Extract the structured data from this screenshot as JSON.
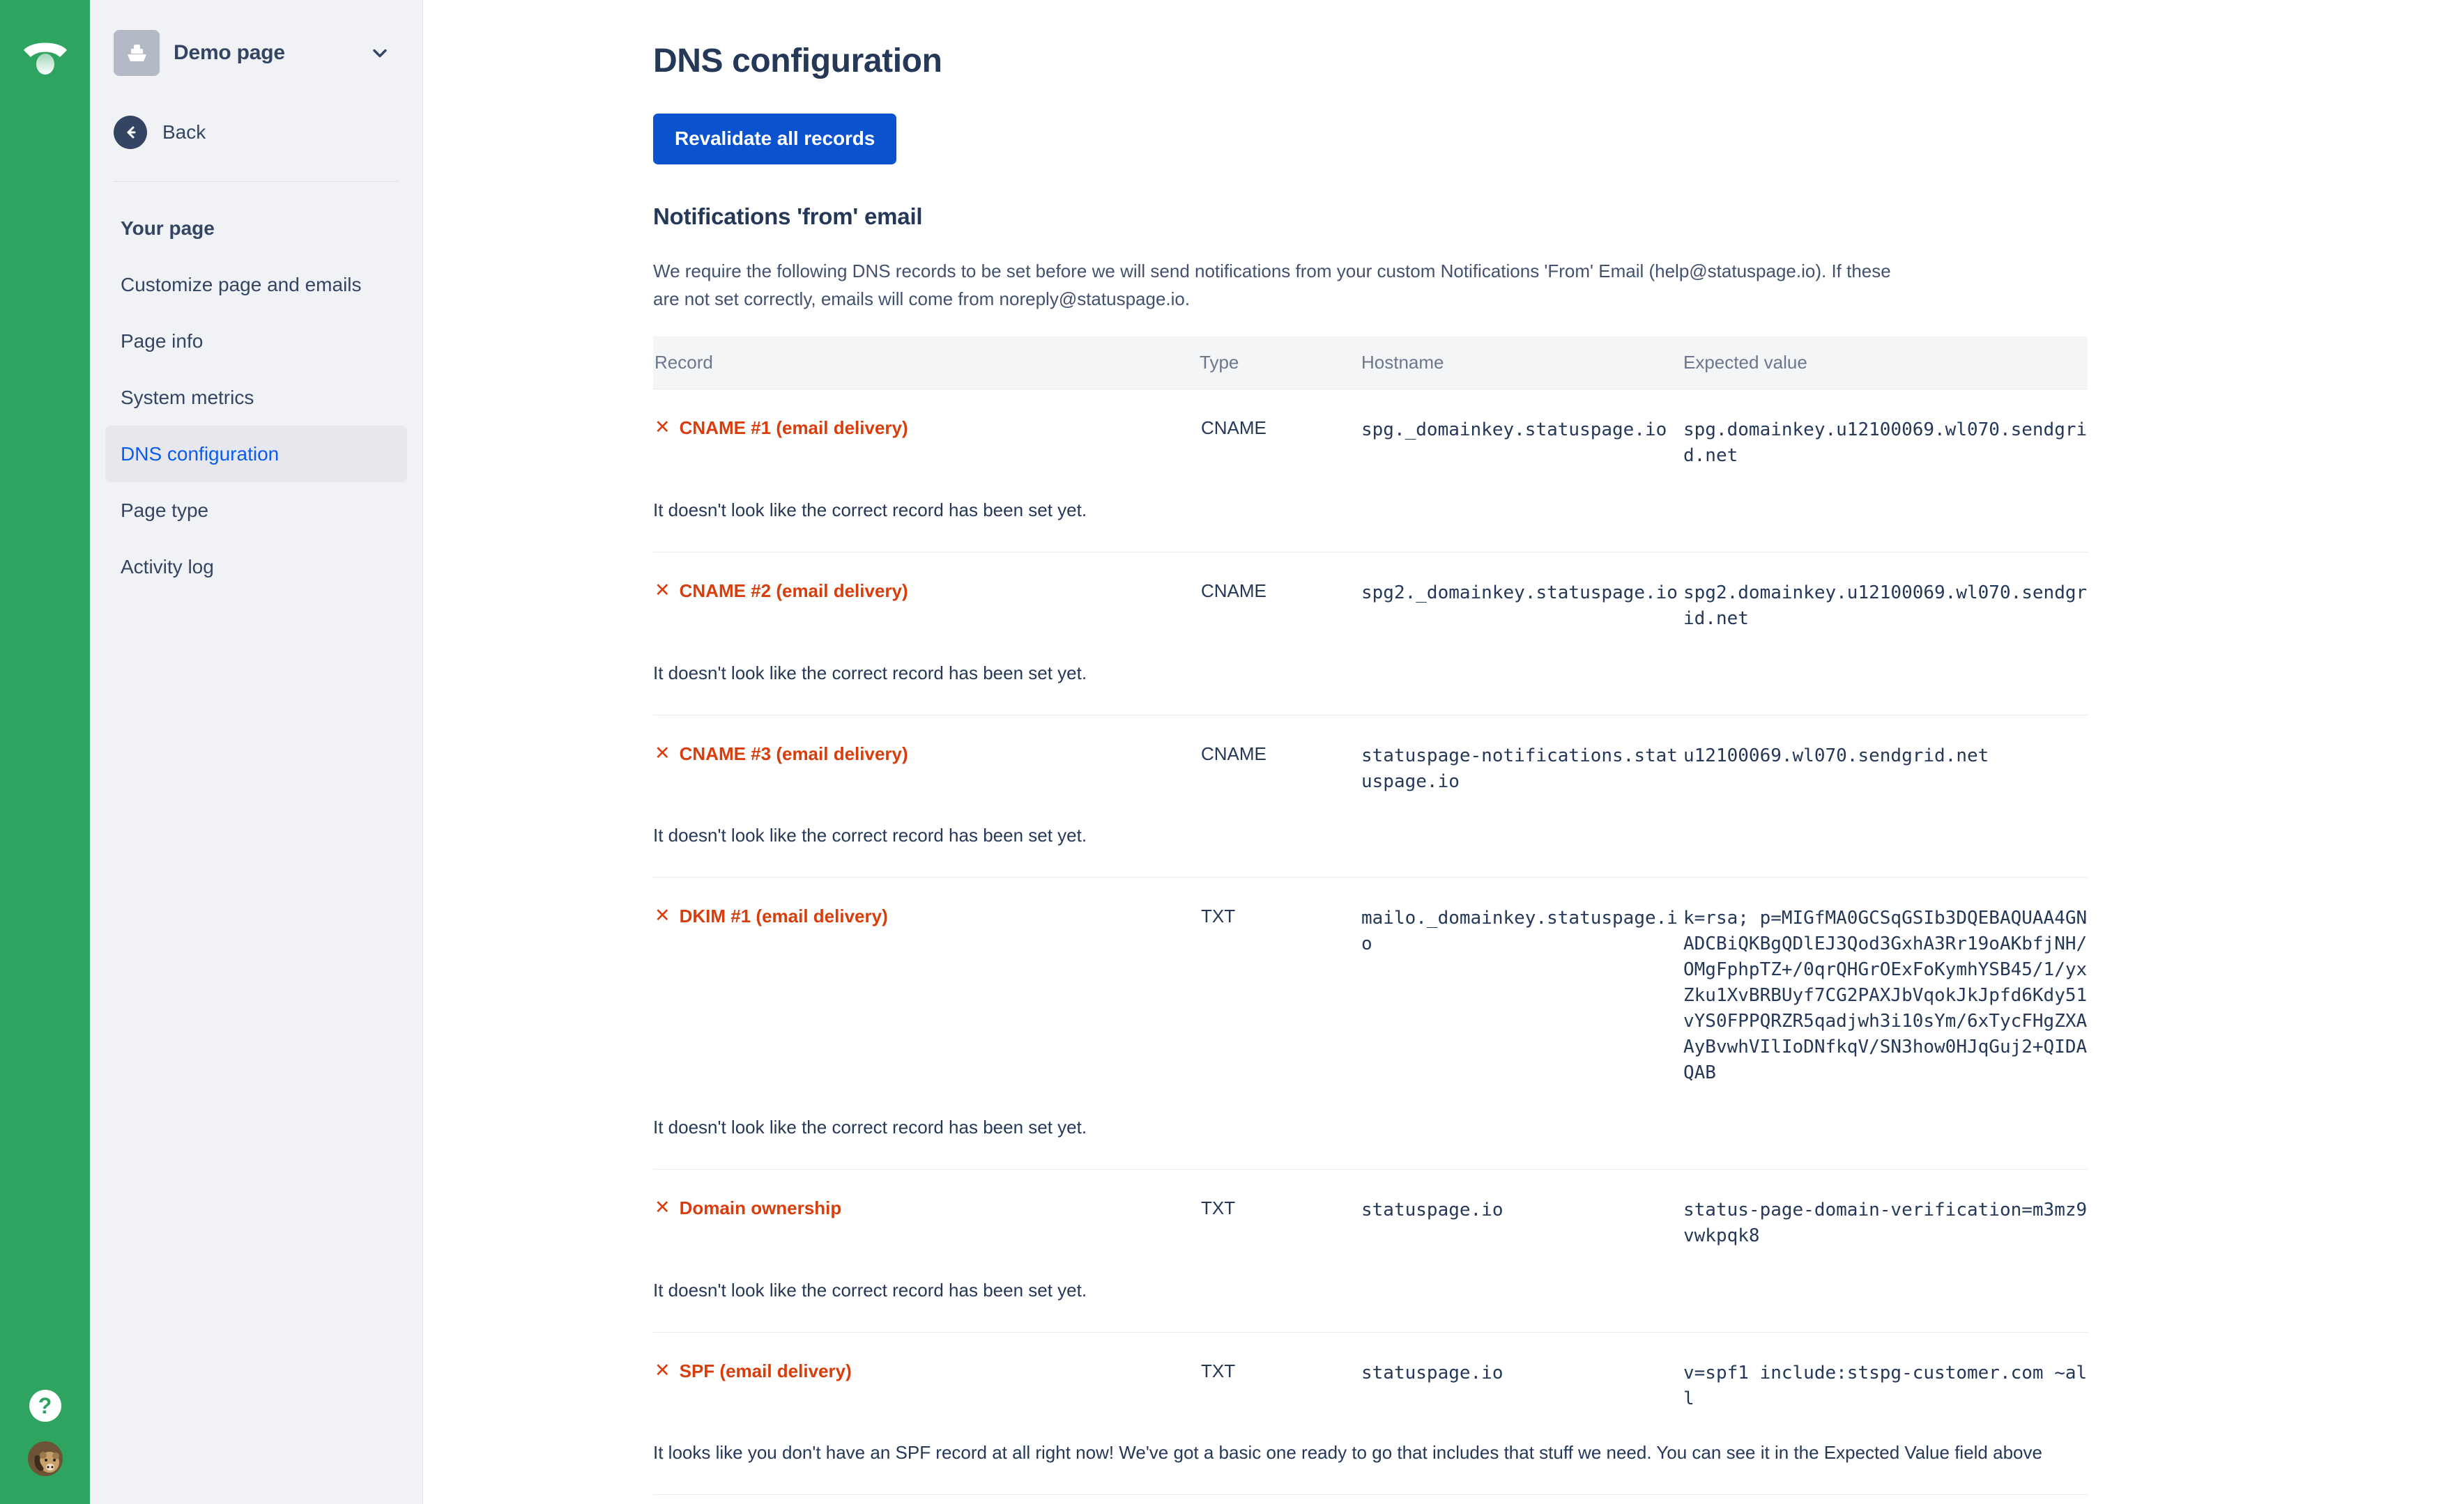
{
  "rail": {
    "logo_icon": "statuspage-logo-icon",
    "help_icon": "question-mark-icon",
    "help_label": "?",
    "avatar_icon": "user-avatar-bear"
  },
  "sidebar": {
    "page_switcher": {
      "thumb_icon": "page-thumbnail-icon",
      "name": "Demo page",
      "chevron_icon": "chevron-down-icon"
    },
    "back": {
      "icon": "arrow-left-circle-icon",
      "label": "Back"
    },
    "nav_items": [
      {
        "label": "Your page",
        "state": "heading"
      },
      {
        "label": "Customize page and emails",
        "state": "normal"
      },
      {
        "label": "Page info",
        "state": "normal"
      },
      {
        "label": "System metrics",
        "state": "normal"
      },
      {
        "label": "DNS configuration",
        "state": "active"
      },
      {
        "label": "Page type",
        "state": "normal"
      },
      {
        "label": "Activity log",
        "state": "normal"
      }
    ]
  },
  "main": {
    "title": "DNS configuration",
    "revalidate_button": "Revalidate all records",
    "section_title": "Notifications 'from' email",
    "section_description": "We require the following DNS records to be set before we will send notifications from your custom Notifications 'From' Email (help@statuspage.io). If these are not set correctly, emails will come from noreply@statuspage.io.",
    "table": {
      "headers": [
        "Record",
        "Type",
        "Hostname",
        "Expected value"
      ],
      "rows": [
        {
          "status_icon": "error-x-icon",
          "record": "CNAME #1 (email delivery)",
          "type": "CNAME",
          "hostname": "spg._domainkey.statuspage.io",
          "expected_value": "spg.domainkey.u12100069.wl070.sendgrid.net",
          "note": "It doesn't look like the correct record has been set yet."
        },
        {
          "status_icon": "error-x-icon",
          "record": "CNAME #2 (email delivery)",
          "type": "CNAME",
          "hostname": "spg2._domainkey.statuspage.io",
          "expected_value": "spg2.domainkey.u12100069.wl070.sendgrid.net",
          "note": "It doesn't look like the correct record has been set yet."
        },
        {
          "status_icon": "error-x-icon",
          "record": "CNAME #3 (email delivery)",
          "type": "CNAME",
          "hostname": "statuspage-notifications.statuspage.io",
          "expected_value": "u12100069.wl070.sendgrid.net",
          "note": "It doesn't look like the correct record has been set yet."
        },
        {
          "status_icon": "error-x-icon",
          "record": "DKIM #1 (email delivery)",
          "type": "TXT",
          "hostname": "mailo._domainkey.statuspage.io",
          "expected_value": "k=rsa; p=MIGfMA0GCSqGSIb3DQEBAQUAA4GNADCBiQKBgQDlEJ3Qod3GxhA3Rr19oAKbfjNH/OMgFphpTZ+/0qrQHGrOExFoKymhYSB45/1/yxZku1XvBRBUyf7CG2PAXJbVqokJkJpfd6Kdy51vYS0FPPQRZR5qadjwh3i10sYm/6xTycFHgZXAAyBvwhVIlIoDNfkqV/SN3how0HJqGuj2+QIDAQAB",
          "note": "It doesn't look like the correct record has been set yet."
        },
        {
          "status_icon": "error-x-icon",
          "record": "Domain ownership",
          "type": "TXT",
          "hostname": "statuspage.io",
          "expected_value": "status-page-domain-verification=m3mz9vwkpqk8",
          "note": "It doesn't look like the correct record has been set yet."
        },
        {
          "status_icon": "error-x-icon",
          "record": "SPF (email delivery)",
          "type": "TXT",
          "hostname": "statuspage.io",
          "expected_value": "v=spf1 include:stspg-customer.com ~all",
          "note": "It looks like you don't have an SPF record at all right now! We've got a basic one ready to go that includes that stuff we need. You can see it in the Expected Value field above"
        }
      ]
    }
  },
  "colors": {
    "rail_green": "#2fa360",
    "sidebar_bg": "#f1f2f5",
    "primary_blue": "#0b53ce",
    "active_link": "#0c5bef",
    "error_red": "#d93d0b",
    "text_dark": "#253858",
    "text_muted": "#6b778c"
  }
}
